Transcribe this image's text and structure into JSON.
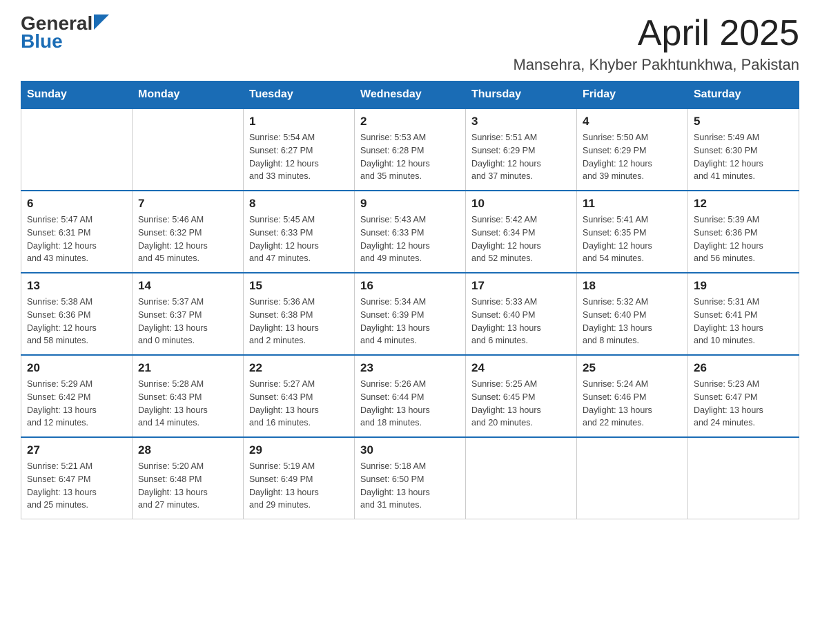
{
  "header": {
    "logo_general": "General",
    "logo_blue": "Blue",
    "month_title": "April 2025",
    "location": "Mansehra, Khyber Pakhtunkhwa, Pakistan"
  },
  "weekdays": [
    "Sunday",
    "Monday",
    "Tuesday",
    "Wednesday",
    "Thursday",
    "Friday",
    "Saturday"
  ],
  "weeks": [
    [
      {
        "day": "",
        "info": ""
      },
      {
        "day": "",
        "info": ""
      },
      {
        "day": "1",
        "info": "Sunrise: 5:54 AM\nSunset: 6:27 PM\nDaylight: 12 hours\nand 33 minutes."
      },
      {
        "day": "2",
        "info": "Sunrise: 5:53 AM\nSunset: 6:28 PM\nDaylight: 12 hours\nand 35 minutes."
      },
      {
        "day": "3",
        "info": "Sunrise: 5:51 AM\nSunset: 6:29 PM\nDaylight: 12 hours\nand 37 minutes."
      },
      {
        "day": "4",
        "info": "Sunrise: 5:50 AM\nSunset: 6:29 PM\nDaylight: 12 hours\nand 39 minutes."
      },
      {
        "day": "5",
        "info": "Sunrise: 5:49 AM\nSunset: 6:30 PM\nDaylight: 12 hours\nand 41 minutes."
      }
    ],
    [
      {
        "day": "6",
        "info": "Sunrise: 5:47 AM\nSunset: 6:31 PM\nDaylight: 12 hours\nand 43 minutes."
      },
      {
        "day": "7",
        "info": "Sunrise: 5:46 AM\nSunset: 6:32 PM\nDaylight: 12 hours\nand 45 minutes."
      },
      {
        "day": "8",
        "info": "Sunrise: 5:45 AM\nSunset: 6:33 PM\nDaylight: 12 hours\nand 47 minutes."
      },
      {
        "day": "9",
        "info": "Sunrise: 5:43 AM\nSunset: 6:33 PM\nDaylight: 12 hours\nand 49 minutes."
      },
      {
        "day": "10",
        "info": "Sunrise: 5:42 AM\nSunset: 6:34 PM\nDaylight: 12 hours\nand 52 minutes."
      },
      {
        "day": "11",
        "info": "Sunrise: 5:41 AM\nSunset: 6:35 PM\nDaylight: 12 hours\nand 54 minutes."
      },
      {
        "day": "12",
        "info": "Sunrise: 5:39 AM\nSunset: 6:36 PM\nDaylight: 12 hours\nand 56 minutes."
      }
    ],
    [
      {
        "day": "13",
        "info": "Sunrise: 5:38 AM\nSunset: 6:36 PM\nDaylight: 12 hours\nand 58 minutes."
      },
      {
        "day": "14",
        "info": "Sunrise: 5:37 AM\nSunset: 6:37 PM\nDaylight: 13 hours\nand 0 minutes."
      },
      {
        "day": "15",
        "info": "Sunrise: 5:36 AM\nSunset: 6:38 PM\nDaylight: 13 hours\nand 2 minutes."
      },
      {
        "day": "16",
        "info": "Sunrise: 5:34 AM\nSunset: 6:39 PM\nDaylight: 13 hours\nand 4 minutes."
      },
      {
        "day": "17",
        "info": "Sunrise: 5:33 AM\nSunset: 6:40 PM\nDaylight: 13 hours\nand 6 minutes."
      },
      {
        "day": "18",
        "info": "Sunrise: 5:32 AM\nSunset: 6:40 PM\nDaylight: 13 hours\nand 8 minutes."
      },
      {
        "day": "19",
        "info": "Sunrise: 5:31 AM\nSunset: 6:41 PM\nDaylight: 13 hours\nand 10 minutes."
      }
    ],
    [
      {
        "day": "20",
        "info": "Sunrise: 5:29 AM\nSunset: 6:42 PM\nDaylight: 13 hours\nand 12 minutes."
      },
      {
        "day": "21",
        "info": "Sunrise: 5:28 AM\nSunset: 6:43 PM\nDaylight: 13 hours\nand 14 minutes."
      },
      {
        "day": "22",
        "info": "Sunrise: 5:27 AM\nSunset: 6:43 PM\nDaylight: 13 hours\nand 16 minutes."
      },
      {
        "day": "23",
        "info": "Sunrise: 5:26 AM\nSunset: 6:44 PM\nDaylight: 13 hours\nand 18 minutes."
      },
      {
        "day": "24",
        "info": "Sunrise: 5:25 AM\nSunset: 6:45 PM\nDaylight: 13 hours\nand 20 minutes."
      },
      {
        "day": "25",
        "info": "Sunrise: 5:24 AM\nSunset: 6:46 PM\nDaylight: 13 hours\nand 22 minutes."
      },
      {
        "day": "26",
        "info": "Sunrise: 5:23 AM\nSunset: 6:47 PM\nDaylight: 13 hours\nand 24 minutes."
      }
    ],
    [
      {
        "day": "27",
        "info": "Sunrise: 5:21 AM\nSunset: 6:47 PM\nDaylight: 13 hours\nand 25 minutes."
      },
      {
        "day": "28",
        "info": "Sunrise: 5:20 AM\nSunset: 6:48 PM\nDaylight: 13 hours\nand 27 minutes."
      },
      {
        "day": "29",
        "info": "Sunrise: 5:19 AM\nSunset: 6:49 PM\nDaylight: 13 hours\nand 29 minutes."
      },
      {
        "day": "30",
        "info": "Sunrise: 5:18 AM\nSunset: 6:50 PM\nDaylight: 13 hours\nand 31 minutes."
      },
      {
        "day": "",
        "info": ""
      },
      {
        "day": "",
        "info": ""
      },
      {
        "day": "",
        "info": ""
      }
    ]
  ]
}
